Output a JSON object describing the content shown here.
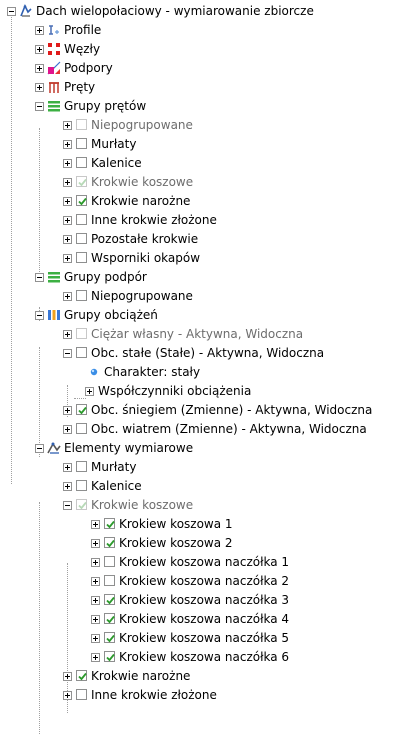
{
  "tree": {
    "root": {
      "label": "Dach wielopołaciowy - wymiarowanie zbiorcze",
      "icon": "roof-model-icon",
      "expanded": true
    },
    "nodes": [
      {
        "label": "Profile",
        "icon": "profile-icon",
        "expanded": false
      },
      {
        "label": "Węzły",
        "icon": "nodes-icon",
        "expanded": false
      },
      {
        "label": "Podpory",
        "icon": "supports-icon",
        "expanded": false
      },
      {
        "label": "Pręty",
        "icon": "bars-icon",
        "expanded": false
      },
      {
        "label": "Grupy prętów",
        "icon": "group-icon",
        "expanded": true
      },
      {
        "label": "Niepogrupowane",
        "checked": false,
        "disabled": true,
        "expanded": false
      },
      {
        "label": "Murłaty",
        "checked": false,
        "expanded": false
      },
      {
        "label": "Kalenice",
        "checked": false,
        "expanded": false
      },
      {
        "label": "Krokwie koszowe",
        "checked": true,
        "disabled": true,
        "expanded": false
      },
      {
        "label": "Krokwie narożne",
        "checked": true,
        "expanded": false
      },
      {
        "label": "Inne krokwie złożone",
        "checked": false,
        "expanded": false
      },
      {
        "label": "Pozostałe krokwie",
        "checked": false,
        "expanded": false
      },
      {
        "label": "Wsporniki okapów",
        "checked": false,
        "expanded": false
      },
      {
        "label": "Grupy podpór",
        "icon": "group-icon",
        "expanded": true
      },
      {
        "label": "Niepogrupowane",
        "checked": false,
        "expanded": false
      },
      {
        "label": "Grupy obciążeń",
        "icon": "load-groups-icon",
        "expanded": true
      },
      {
        "label": "Ciężar własny - Aktywna, Widoczna",
        "checked": false,
        "disabled": true,
        "expanded": false
      },
      {
        "label": "Obc. stałe (Stałe) - Aktywna, Widoczna",
        "checked": false,
        "expanded": true
      },
      {
        "label": "Charakter: stały",
        "icon": "bullet-icon"
      },
      {
        "label": "Współczynniki obciążenia",
        "expanded": false
      },
      {
        "label": "Obc. śniegiem (Zmienne) - Aktywna, Widoczna",
        "checked": true,
        "expanded": false
      },
      {
        "label": "Obc. wiatrem (Zmienne) - Aktywna, Widoczna",
        "checked": false,
        "expanded": false
      },
      {
        "label": "Elementy wymiarowe",
        "icon": "design-elements-icon",
        "expanded": true
      },
      {
        "label": "Murłaty",
        "checked": false,
        "expanded": false
      },
      {
        "label": "Kalenice",
        "checked": false,
        "expanded": false
      },
      {
        "label": "Krokwie koszowe",
        "checked": true,
        "disabled": true,
        "expanded": true
      },
      {
        "label": "Krokiew koszowa 1",
        "checked": true,
        "expanded": false
      },
      {
        "label": "Krokiew koszowa 2",
        "checked": true,
        "expanded": false
      },
      {
        "label": "Krokiew koszowa naczółka 1",
        "checked": false,
        "expanded": false
      },
      {
        "label": "Krokiew koszowa naczółka 2",
        "checked": false,
        "expanded": false
      },
      {
        "label": "Krokiew koszowa naczółka 3",
        "checked": true,
        "expanded": false
      },
      {
        "label": "Krokiew koszowa naczółka 4",
        "checked": true,
        "expanded": false
      },
      {
        "label": "Krokiew koszowa naczółka 5",
        "checked": true,
        "expanded": false
      },
      {
        "label": "Krokiew koszowa naczółka 6",
        "checked": true,
        "expanded": false
      },
      {
        "label": "Krokwie narożne",
        "checked": true,
        "expanded": false
      },
      {
        "label": "Inne krokwie złożone",
        "checked": false,
        "expanded": false
      }
    ]
  },
  "colors": {
    "check": "#2b9a2b",
    "guide": "#a0a0a0",
    "group_green": "#3cb043",
    "bullet_blue": "#3a8ee6"
  }
}
